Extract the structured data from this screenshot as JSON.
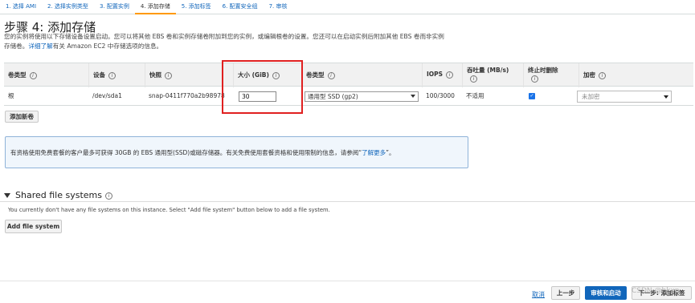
{
  "steps": [
    {
      "label": "1. 选择 AMI"
    },
    {
      "label": "2. 选择实例类型"
    },
    {
      "label": "3. 配置实例"
    },
    {
      "label": "4. 添加存储"
    },
    {
      "label": "5. 添加标签"
    },
    {
      "label": "6. 配置安全组"
    },
    {
      "label": "7. 审核"
    }
  ],
  "title": "步骤 4: 添加存储",
  "intro": {
    "line1": "您的实例将使用以下存储设备设置启动。您可以将其他 EBS 卷和实例存储卷附加到您的实例，或编辑根卷的设置。您还可以在启动实例后附加其他 EBS 卷而非实例",
    "line2_pre": "存储卷。",
    "link": "详细了解",
    "line2_post": "有关 Amazon EC2 中存储选项的信息。"
  },
  "table": {
    "headers": {
      "volume_type": "卷类型",
      "device": "设备",
      "snapshot": "快照",
      "size": "大小 (GiB)",
      "ebs_type": "卷类型",
      "iops": "IOPS",
      "throughput": "吞吐量 (MB/s)",
      "delete_on_term": "终止时删除",
      "encryption": "加密"
    },
    "row": {
      "volume_type": "根",
      "device": "/dev/sda1",
      "snapshot": "snap-0411f770a2b98978",
      "size": "30",
      "ebs_type": "通用型 SSD (gp2)",
      "iops": "100/3000",
      "throughput": "不适用",
      "delete_on_term": true,
      "encryption": "未加密"
    },
    "info_glyph": "i"
  },
  "buttons": {
    "add_volume": "添加新卷",
    "add_file_system": "Add file system",
    "cancel": "取消",
    "previous": "上一步",
    "review_launch": "审核和启动",
    "next": "下一步: 添加标签"
  },
  "notice": {
    "text": "有资格使用免费套餐的客户最多可获得 30GB 的 EBS 通用型(SSD)或磁存储器。有关免费使用套餐资格和使用限制的信息，请参阅“",
    "link": "了解更多",
    "suffix": "”。"
  },
  "shared_fs": {
    "title": "Shared file systems",
    "text": "You currently don't have any file systems on this instance. Select \"Add file system\" button below to add a file system."
  },
  "watermark": "CSDN @hkxp",
  "colors": {
    "accent": "#1166bb",
    "highlight": "#e02020",
    "active_step": "#ff9900"
  }
}
